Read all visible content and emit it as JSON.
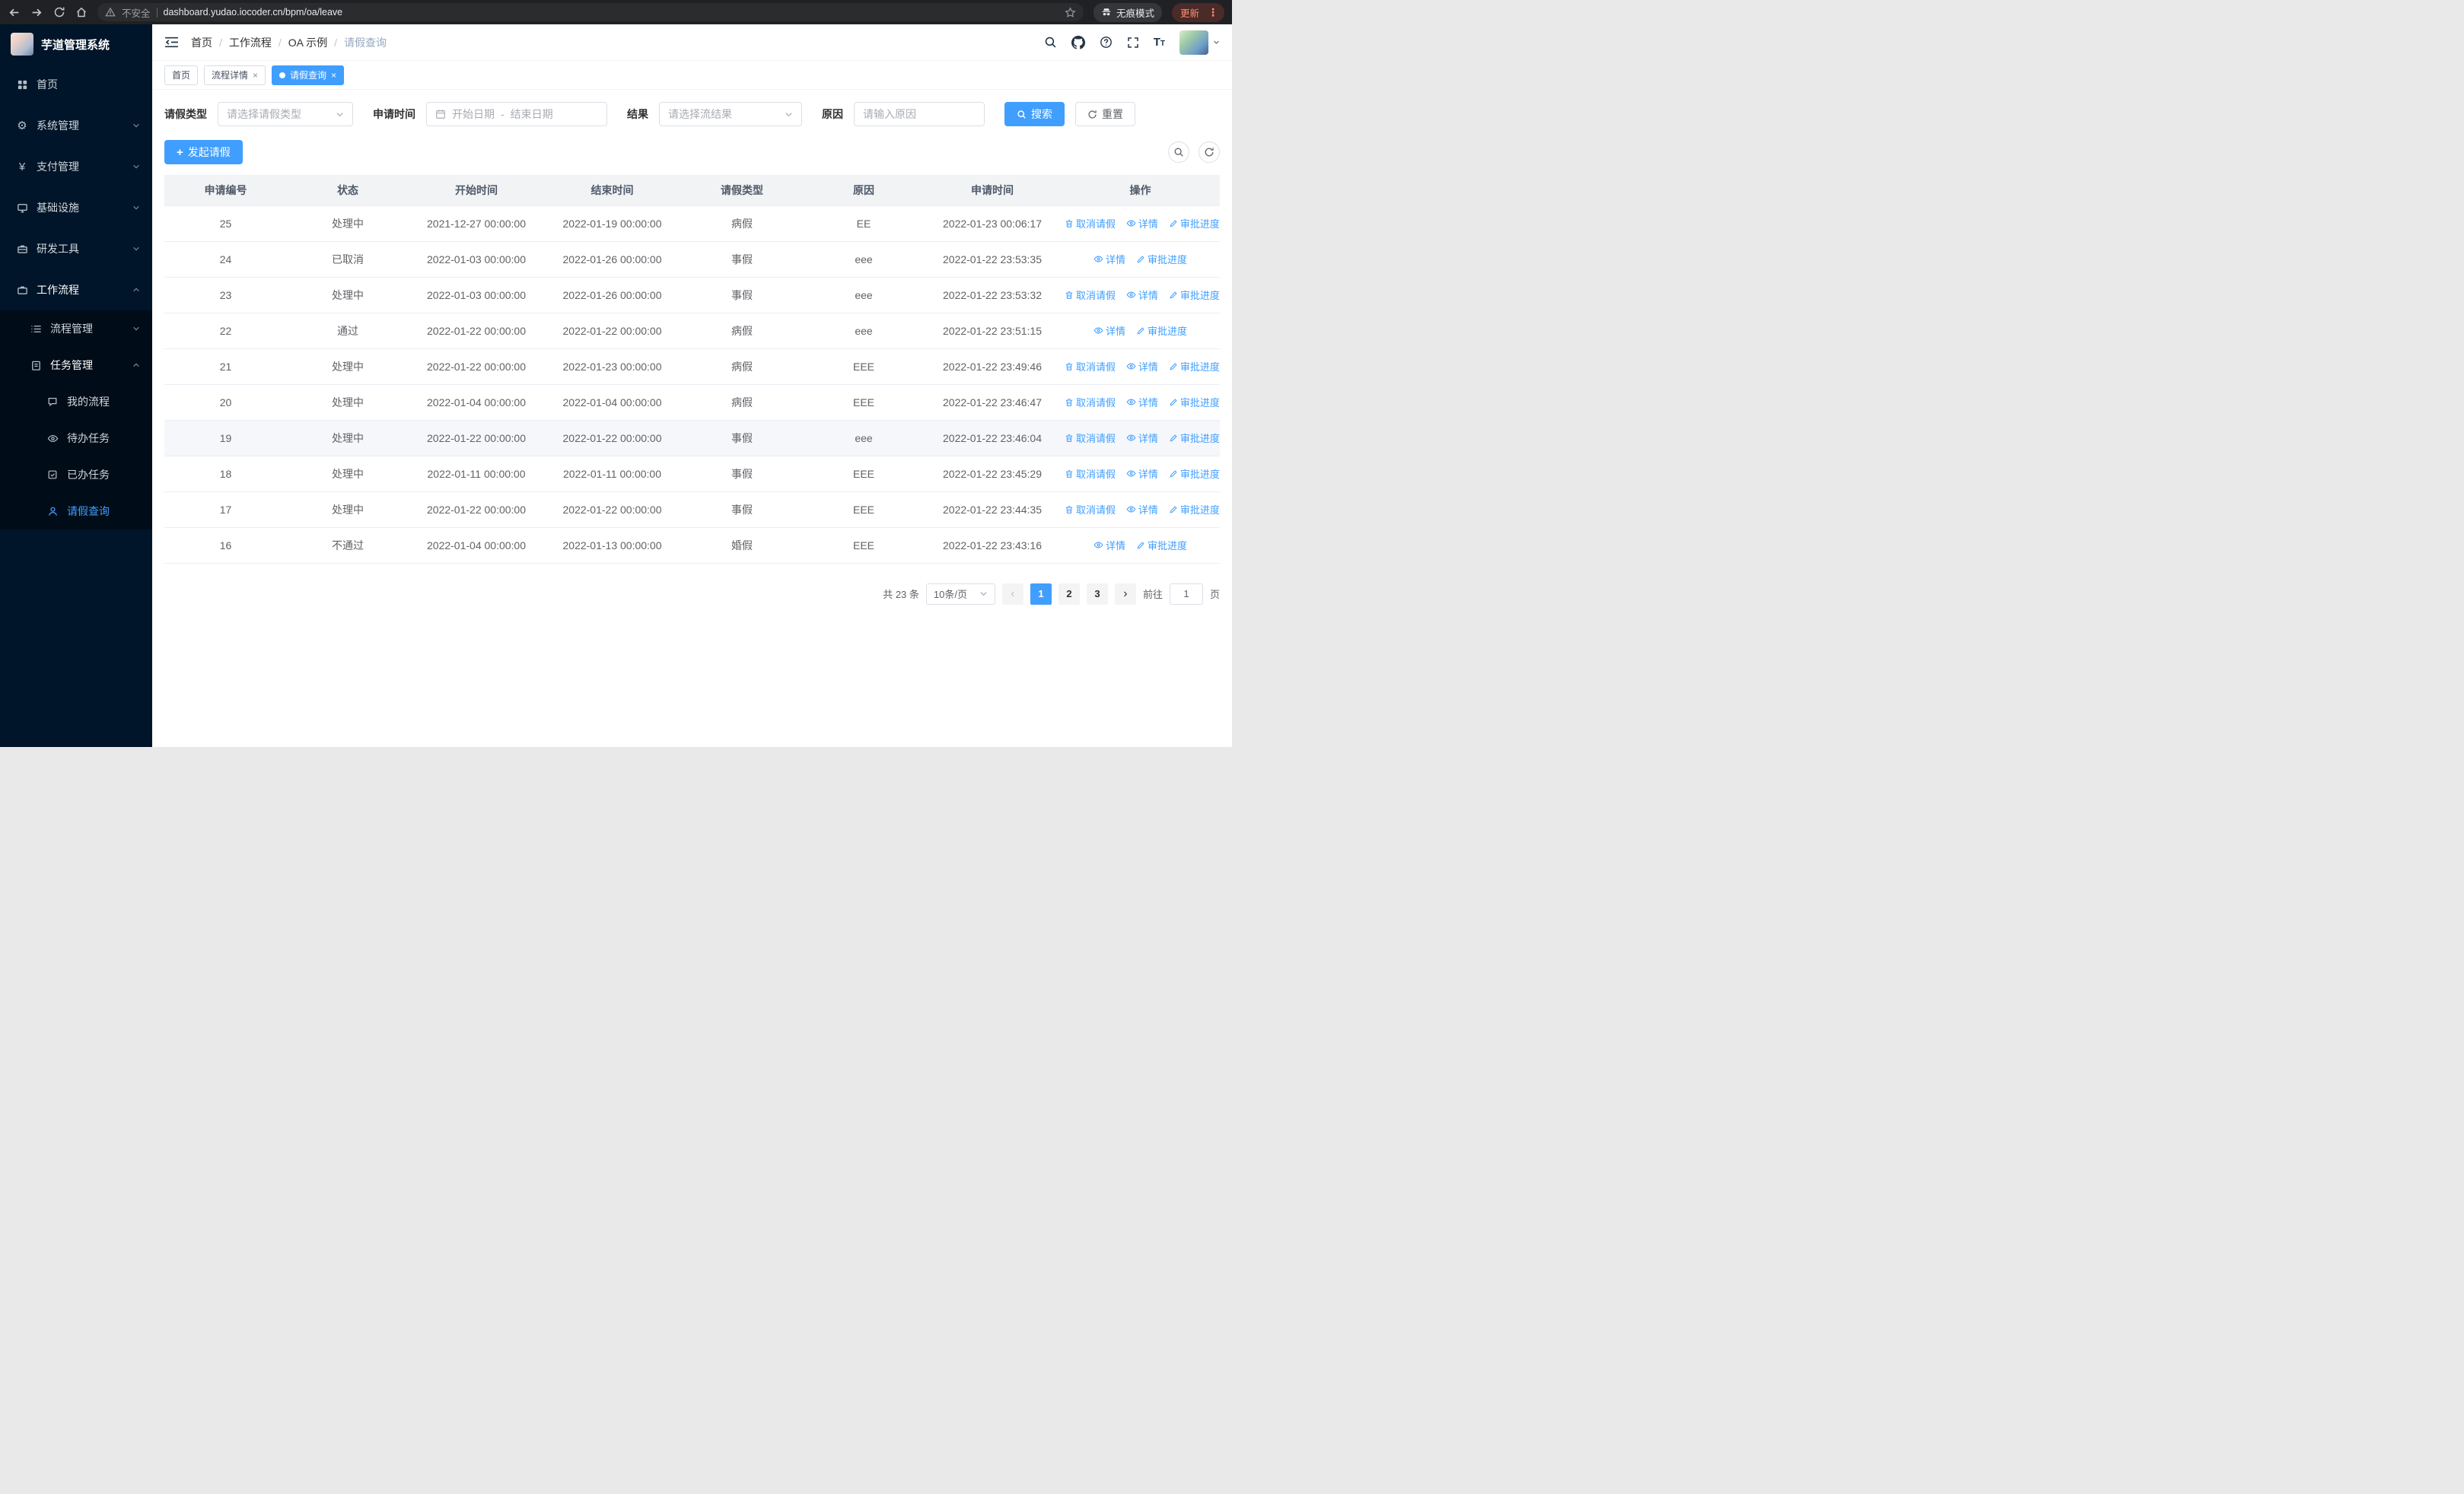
{
  "colors": {
    "accent": "#409eff",
    "sidebar_bg": "#001529"
  },
  "browser": {
    "security_label": "不安全",
    "url": "dashboard.yudao.iocoder.cn/bpm/oa/leave",
    "incognito_label": "无痕模式",
    "update_label": "更新"
  },
  "ui": {
    "breadcrumb_sep": "/",
    "close": "×",
    "prev": "‹",
    "next": "›"
  },
  "sidebar": {
    "app_title": "芋道管理系统",
    "items": [
      {
        "label": "首页",
        "icon": "dashboard-icon"
      },
      {
        "label": "系统管理",
        "icon": "gear-icon"
      },
      {
        "label": "支付管理",
        "icon": "yen-icon"
      },
      {
        "label": "基础设施",
        "icon": "monitor-icon"
      },
      {
        "label": "研发工具",
        "icon": "briefcase-icon"
      },
      {
        "label": "工作流程",
        "icon": "briefcase-icon"
      },
      {
        "label": "流程管理",
        "icon": "list-icon"
      },
      {
        "label": "任务管理",
        "icon": "clipboard-icon"
      },
      {
        "label": "我的流程",
        "icon": "chat-icon"
      },
      {
        "label": "待办任务",
        "icon": "eye-icon"
      },
      {
        "label": "已办任务",
        "icon": "check-square-icon"
      },
      {
        "label": "请假查询",
        "icon": "person-icon"
      }
    ]
  },
  "header": {
    "breadcrumb": [
      "首页",
      "工作流程",
      "OA 示例",
      "请假查询"
    ]
  },
  "tabs": [
    {
      "label": "首页",
      "closable": false,
      "active": false
    },
    {
      "label": "流程详情",
      "closable": true,
      "active": false
    },
    {
      "label": "请假查询",
      "closable": true,
      "active": true
    }
  ],
  "filters": {
    "leave_type_label": "请假类型",
    "leave_type_placeholder": "请选择请假类型",
    "apply_time_label": "申请时间",
    "start_date_placeholder": "开始日期",
    "date_separator": "-",
    "end_date_placeholder": "结束日期",
    "result_label": "结果",
    "result_placeholder": "请选择流结果",
    "reason_label": "原因",
    "reason_placeholder": "请输入原因",
    "search_label": "搜索",
    "reset_label": "重置"
  },
  "toolbar": {
    "create_label": "发起请假"
  },
  "table": {
    "columns": [
      "申请编号",
      "状态",
      "开始时间",
      "结束时间",
      "请假类型",
      "原因",
      "申请时间",
      "操作"
    ],
    "action_labels": {
      "cancel": "取消请假",
      "detail": "详情",
      "progress": "审批进度"
    },
    "rows": [
      {
        "id": "25",
        "status": "处理中",
        "start": "2021-12-27 00:00:00",
        "end": "2022-01-19 00:00:00",
        "type": "病假",
        "reason": "EE",
        "apply_time": "2022-01-23 00:06:17",
        "cancelable": true,
        "highlighted": false
      },
      {
        "id": "24",
        "status": "已取消",
        "start": "2022-01-03 00:00:00",
        "end": "2022-01-26 00:00:00",
        "type": "事假",
        "reason": "eee",
        "apply_time": "2022-01-22 23:53:35",
        "cancelable": false,
        "highlighted": false
      },
      {
        "id": "23",
        "status": "处理中",
        "start": "2022-01-03 00:00:00",
        "end": "2022-01-26 00:00:00",
        "type": "事假",
        "reason": "eee",
        "apply_time": "2022-01-22 23:53:32",
        "cancelable": true,
        "highlighted": false
      },
      {
        "id": "22",
        "status": "通过",
        "start": "2022-01-22 00:00:00",
        "end": "2022-01-22 00:00:00",
        "type": "病假",
        "reason": "eee",
        "apply_time": "2022-01-22 23:51:15",
        "cancelable": false,
        "highlighted": false
      },
      {
        "id": "21",
        "status": "处理中",
        "start": "2022-01-22 00:00:00",
        "end": "2022-01-23 00:00:00",
        "type": "病假",
        "reason": "EEE",
        "apply_time": "2022-01-22 23:49:46",
        "cancelable": true,
        "highlighted": false
      },
      {
        "id": "20",
        "status": "处理中",
        "start": "2022-01-04 00:00:00",
        "end": "2022-01-04 00:00:00",
        "type": "病假",
        "reason": "EEE",
        "apply_time": "2022-01-22 23:46:47",
        "cancelable": true,
        "highlighted": false
      },
      {
        "id": "19",
        "status": "处理中",
        "start": "2022-01-22 00:00:00",
        "end": "2022-01-22 00:00:00",
        "type": "事假",
        "reason": "eee",
        "apply_time": "2022-01-22 23:46:04",
        "cancelable": true,
        "highlighted": true
      },
      {
        "id": "18",
        "status": "处理中",
        "start": "2022-01-11 00:00:00",
        "end": "2022-01-11 00:00:00",
        "type": "事假",
        "reason": "EEE",
        "apply_time": "2022-01-22 23:45:29",
        "cancelable": true,
        "highlighted": false
      },
      {
        "id": "17",
        "status": "处理中",
        "start": "2022-01-22 00:00:00",
        "end": "2022-01-22 00:00:00",
        "type": "事假",
        "reason": "EEE",
        "apply_time": "2022-01-22 23:44:35",
        "cancelable": true,
        "highlighted": false
      },
      {
        "id": "16",
        "status": "不通过",
        "start": "2022-01-04 00:00:00",
        "end": "2022-01-13 00:00:00",
        "type": "婚假",
        "reason": "EEE",
        "apply_time": "2022-01-22 23:43:16",
        "cancelable": false,
        "highlighted": false
      }
    ]
  },
  "pagination": {
    "total_label": "共 23 条",
    "page_size": "10条/页",
    "pages": [
      "1",
      "2",
      "3"
    ],
    "active_page": "1",
    "goto_label": "前往",
    "goto_value": "1",
    "page_label": "页"
  }
}
